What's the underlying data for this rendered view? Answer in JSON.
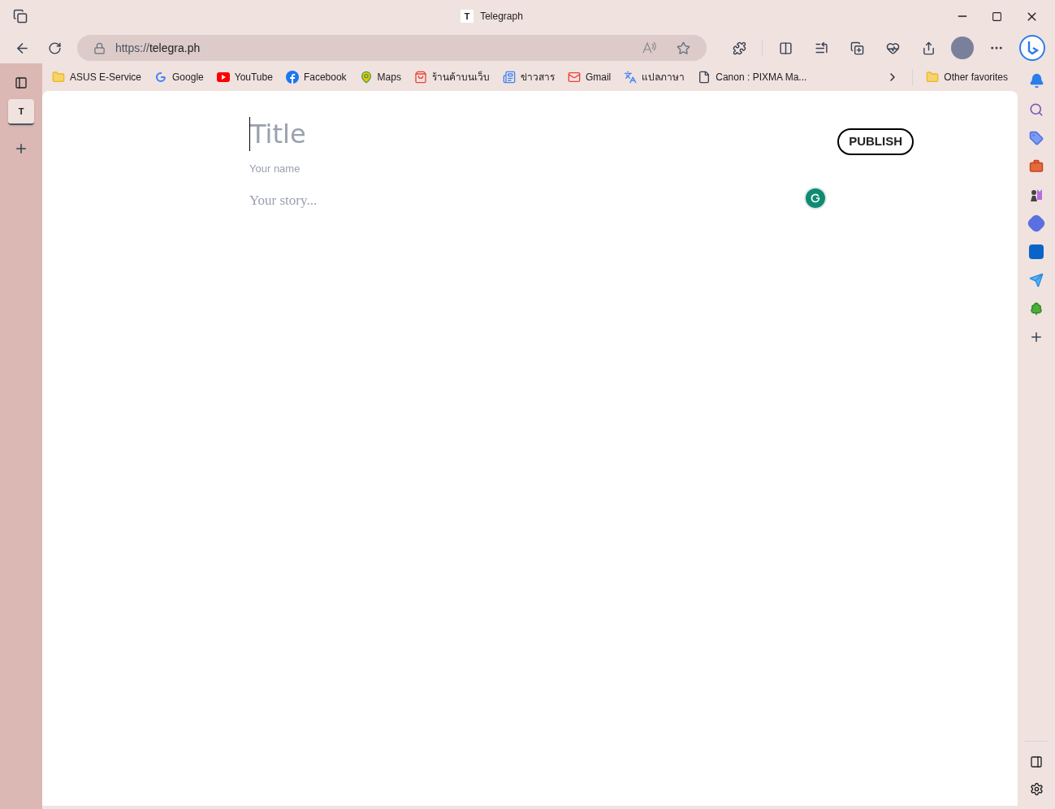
{
  "window": {
    "title": "Telegraph",
    "tab_icon": "T"
  },
  "address_bar": {
    "scheme": "https://",
    "host": "telegra.ph"
  },
  "vertical_tabs": [
    {
      "label": "T",
      "selected": true
    }
  ],
  "bookmarks": [
    {
      "label": "ASUS E-Service",
      "kind": "folder"
    },
    {
      "label": "Google",
      "kind": "google"
    },
    {
      "label": "YouTube",
      "kind": "youtube"
    },
    {
      "label": "Facebook",
      "kind": "facebook"
    },
    {
      "label": "Maps",
      "kind": "maps"
    },
    {
      "label": "ร้านค้าบนเว็บ",
      "kind": "store"
    },
    {
      "label": "ข่าวสาร",
      "kind": "news"
    },
    {
      "label": "Gmail",
      "kind": "gmail"
    },
    {
      "label": "แปลภาษา",
      "kind": "translate"
    },
    {
      "label": "Canon : PIXMA Ma...",
      "kind": "page"
    }
  ],
  "other_favorites": {
    "label": "Other favorites"
  },
  "editor": {
    "title_placeholder": "Title",
    "author_placeholder": "Your name",
    "story_placeholder": "Your story...",
    "publish": "PUBLISH"
  }
}
